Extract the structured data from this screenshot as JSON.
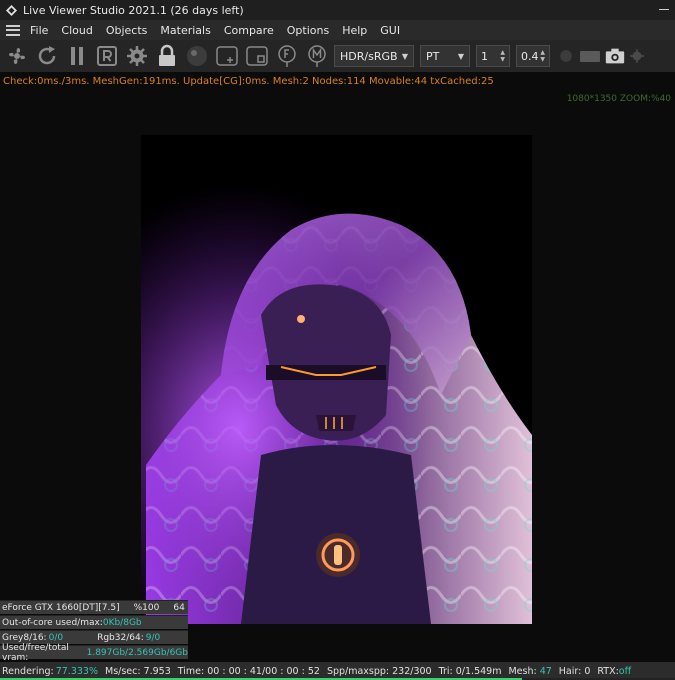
{
  "window": {
    "title": "Live Viewer Studio 2021.1 (26 days left)"
  },
  "menu": [
    "File",
    "Cloud",
    "Objects",
    "Materials",
    "Compare",
    "Options",
    "Help",
    "GUI"
  ],
  "toolbar": {
    "color_mode": "HDR/sRGB",
    "kernel": "PT",
    "spinner_1": "1",
    "spinner_2": "0.4",
    "icons": [
      "fan-icon",
      "refresh-icon",
      "pause-icon",
      "r-icon",
      "gear-icon",
      "lock-icon",
      "sphere-icon",
      "add-region-icon",
      "region-icon",
      "focus-icon",
      "material-icon",
      "record-icon",
      "rect-icon",
      "camera-icon",
      "settings-icon"
    ]
  },
  "stats": {
    "line": "Check:0ms./3ms. MeshGen:191ms. Update[CG]:0ms. Mesh:2 Nodes:114 Movable:44 txCached:25",
    "resolution": "1080*1350 ZOOM:%40"
  },
  "gpu": {
    "device": "eForce GTX 1660[DT][7.5]",
    "usage": "%100",
    "count": "64",
    "ooc_label": "Out-of-core used/max:",
    "ooc_value": "0Kb/8Gb",
    "grey_label": "Grey8/16:",
    "grey_value": "0/0",
    "rgb_label": "Rgb32/64:",
    "rgb_value": "9/0",
    "vram_label": "Used/free/total vram:",
    "vram_value": "1.897Gb/2.569Gb/6Gb"
  },
  "status": {
    "rendering_label": "Rendering:",
    "rendering_value": "77.333%",
    "ms_label": "Ms/sec:",
    "ms_value": "7.953",
    "time_label": "Time:",
    "time_value": "00 : 00 : 41/00 : 00 : 52",
    "spp_label": "Spp/maxspp:",
    "spp_value": "232/300",
    "tri_label": "Tri:",
    "tri_value": "0/1.549m",
    "mesh_label": "Mesh:",
    "mesh_value": "47",
    "hair_label": "Hair:",
    "hair_value": "0",
    "rtx_label": "RTX:",
    "rtx_value": "off",
    "progress_fraction": 0.7733
  },
  "colors": {
    "accent_orange": "#d8801e",
    "value_teal": "#35c4b4",
    "progress_green": "#3fd06a"
  }
}
